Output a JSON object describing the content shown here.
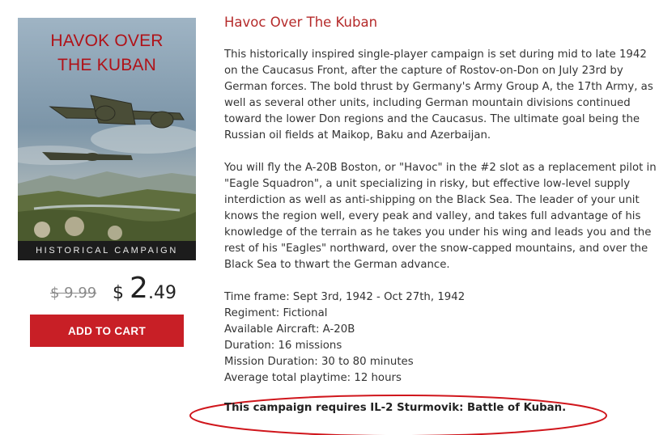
{
  "product": {
    "title": "Havoc Over The Kuban",
    "description": [
      "This historically inspired single-player campaign is set during mid to late 1942 on the Caucasus Front, after the capture of Rostov-on-Don on July 23rd by German forces. The bold thrust by Germany's Army Group A, the 17th Army, as well as several other units, including German mountain divisions continued toward the lower Don regions and the Caucasus. The ultimate goal being the Russian oil fields at Maikop, Baku and Azerbaijan.",
      "You will fly the A-20B Boston, or \"Havoc\" in the #2 slot as a replacement pilot in \"Eagle Squadron\", a unit specializing in risky, but effective low-level supply interdiction as well as anti-shipping on the Black Sea. The leader of your unit knows the region well, every peak and valley, and takes full advantage of his knowledge of the terrain as he takes you under his wing and leads you and the rest of his \"Eagles\" northward, over the snow-capped mountains, and over the Black Sea to thwart the German advance."
    ],
    "details": [
      "Time frame: Sept 3rd, 1942 - Oct 27th, 1942",
      "Regiment: Fictional",
      "Available Aircraft: A-20B",
      "Duration: 16 missions",
      "Mission Duration: 30 to 80 minutes",
      "Average total playtime: 12 hours"
    ],
    "requirement": "This campaign requires IL-2 Sturmovik: Battle of Kuban."
  },
  "cover": {
    "title_line1": "HAVOK OVER",
    "title_line2": "THE KUBAN",
    "band_text": "HISTORICAL CAMPAIGN",
    "image_subject": "A-20 Havoc bombers over river valley"
  },
  "pricing": {
    "old_price": "$ 9.99",
    "currency": "$",
    "price_int": "2",
    "price_dec": ".49",
    "add_to_cart_label": "ADD TO CART"
  },
  "colors": {
    "accent_red": "#c81f26",
    "title_red": "#b52a2a",
    "annotation_red": "#d0161c"
  }
}
